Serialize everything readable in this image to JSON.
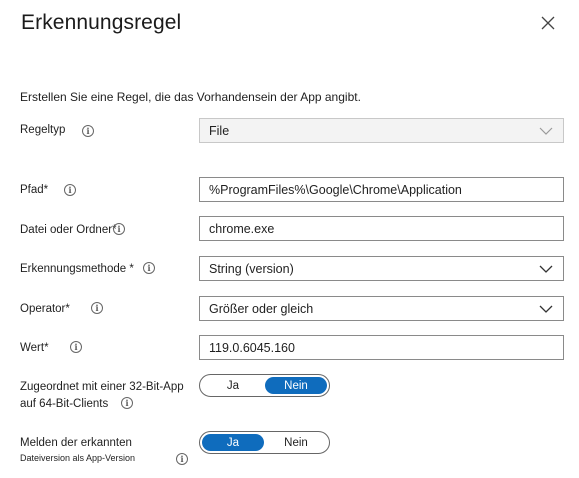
{
  "header": {
    "title": "Erkennungsregel"
  },
  "description": "Erstellen Sie eine Regel, die das Vorhandensein der App angibt.",
  "fields": {
    "regeltyp": {
      "label": "Regeltyp",
      "value": "File"
    },
    "pfad": {
      "label": "Pfad*",
      "value": "%ProgramFiles%\\Google\\Chrome\\Application"
    },
    "datei": {
      "label": "Datei oder Ordner*",
      "value": "chrome.exe"
    },
    "methode": {
      "label": "Erkennungsmethode *",
      "value": "String (version)"
    },
    "operator": {
      "label": "Operator*",
      "value": "Größer oder gleich"
    },
    "wert": {
      "label": "Wert*",
      "value": "119.0.6045.160"
    }
  },
  "toggles": {
    "bit32": {
      "label_line1": "Zugeordnet mit einer 32-Bit-App",
      "label_line2": "auf 64-Bit-Clients",
      "option_yes": "Ja",
      "option_no": "Nein",
      "selected": "Nein"
    },
    "report": {
      "label_line1": "Melden der erkannten",
      "label_line2": "Dateiversion als App-Version",
      "option_yes": "Ja",
      "option_no": "Nein",
      "selected": "Ja"
    }
  },
  "icons": {
    "close": "close-icon",
    "info": "info-icon",
    "dropdown": "chevron-down-icon"
  },
  "colors": {
    "accent": "#0f6cbd"
  }
}
